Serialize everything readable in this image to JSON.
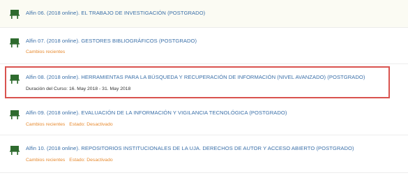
{
  "courses": [
    {
      "title": "Alfin 06. (2018 online). EL TRABAJO DE INVESTIGACIÓN (POSTGRADO)",
      "icon": "course-board-icon"
    },
    {
      "title": "Alfin 07. (2018 online). GESTORES BIBLIOGRÁFICOS (POSTGRADO)",
      "recent_label": "Cambios recientes",
      "icon": "course-board-icon"
    },
    {
      "title": "Alfin 08. (2018 online). HERRAMIENTAS PARA LA BÚSQUEDA Y RECUPERACIÓN DE INFORMACIÓN (NIVEL AVANZADO) (POSTGRADO)",
      "duration": "Duración del Curso: 16. May 2018 - 31. May 2018",
      "icon": "course-board-icon"
    },
    {
      "title": "Alfin 09. (2018 online). EVALUACIÓN DE LA INFORMACIÓN Y VIGILANCIA TECNOLÓGICA (POSTGRADO)",
      "recent_label": "Cambios recientes",
      "status_label": "Estado: Desactivado",
      "icon": "course-board-icon"
    },
    {
      "title": "Alfin 10. (2018 online). REPOSITORIOS INSTITUCIONALES DE LA UJA. DERECHOS DE AUTOR Y ACCESO ABIERTO (POSTGRADO)",
      "recent_label": "Cambios recientes",
      "status_label": "Estado: Desactivado",
      "icon": "course-board-icon"
    }
  ],
  "colors": {
    "link": "#3a6fa8",
    "meta": "#e78a2f",
    "highlight_border": "#d9534f",
    "icon": "#2e6b2e"
  }
}
